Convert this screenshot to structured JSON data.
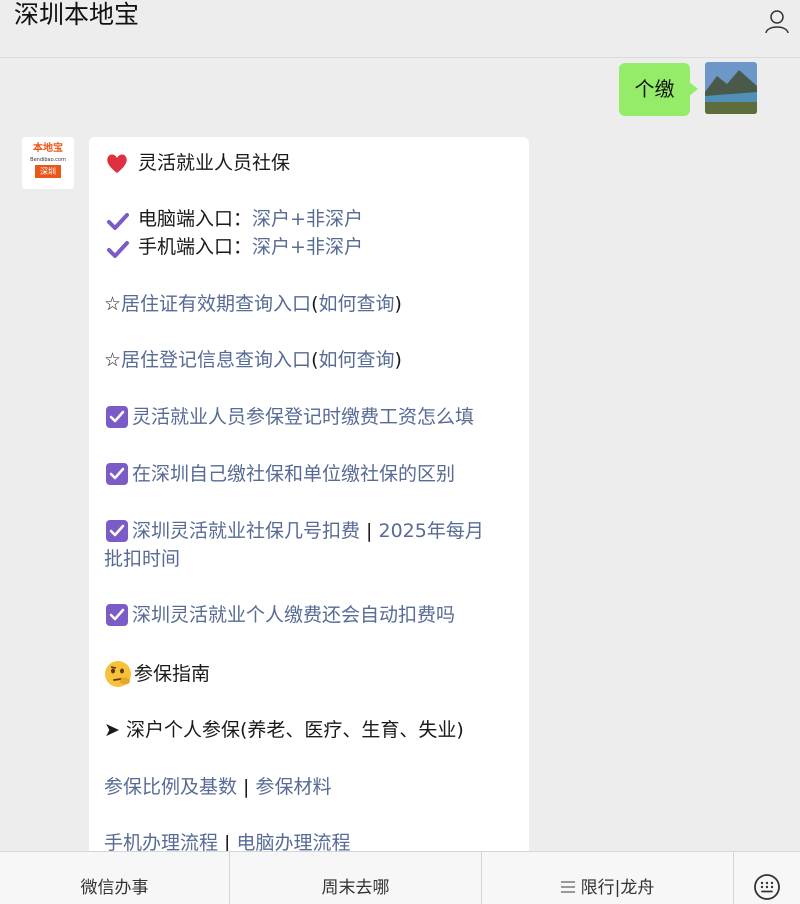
{
  "header": {
    "title": "深圳本地宝",
    "user_icon": "user-icon"
  },
  "outgoing": {
    "text": "个缴"
  },
  "bot": {
    "logo": {
      "name": "本地宝",
      "domain": "Bendibao.com",
      "city": "深圳"
    }
  },
  "message": {
    "title": "灵活就业人员社保",
    "pc_label": "电脑端入口：",
    "mobile_label": "手机端入口：",
    "link_shenhu": "深户",
    "plus": "+",
    "link_feishenhu": "非深户",
    "star": "☆",
    "residence_permit": "居住证有效期查询入口",
    "how_query": "如何查询",
    "paren_open": "(",
    "paren_close": ")",
    "residence_register": "居住登记信息查询入口",
    "article1": "灵活就业人员参保登记时缴费工资怎么填",
    "article2": "在深圳自己缴社保和单位缴社保的区别",
    "article3_part1": "深圳灵活就业社保几号扣费",
    "article3_sep": " | ",
    "article3_part2": "2025年每月",
    "article3_part3": "批扣时间",
    "article4": "深圳灵活就业个人缴费还会自动扣费吗",
    "guide_title": "参保指南",
    "arrow": "➤",
    "hukou_line": "深户个人参保(养老、医疗、生育、失业)",
    "ratio": "参保比例及基数",
    "materials": "参保材料",
    "mobile_process": "手机办理流程",
    "pc_process": "电脑办理流程",
    "pipe": " | "
  },
  "menu": {
    "item1": "微信办事",
    "item2": "周末去哪",
    "item3": "限行|龙舟",
    "keyboard_icon": "keyboard-icon"
  },
  "colors": {
    "link": "#576b95",
    "bubble_out": "#95ec69",
    "check": "#7b5cc7",
    "heart": "#e0303f"
  }
}
